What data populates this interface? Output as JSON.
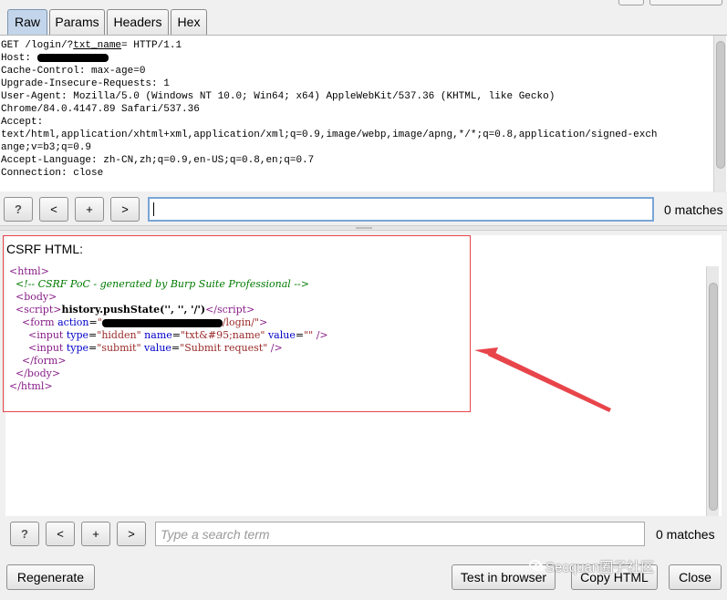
{
  "tabs": [
    "Raw",
    "Params",
    "Headers",
    "Hex"
  ],
  "request": {
    "line1_pre": "GET /login/?",
    "line1_ul": "txt_name",
    "line1_post": "= HTTP/1.1",
    "host_label": "Host: ",
    "lines": [
      "Cache-Control: max-age=0",
      "Upgrade-Insecure-Requests: 1",
      "User-Agent: Mozilla/5.0 (Windows NT 10.0; Win64; x64) AppleWebKit/537.36 (KHTML, like Gecko)",
      "Chrome/84.0.4147.89 Safari/537.36",
      "Accept:",
      "text/html,application/xhtml+xml,application/xml;q=0.9,image/webp,image/apng,*/*;q=0.8,application/signed-exch",
      "ange;v=b3;q=0.9",
      "Accept-Language: zh-CN,zh;q=0.9,en-US;q=0.8,en;q=0.7",
      "Connection: close"
    ]
  },
  "search1": {
    "help": "?",
    "prev": "<",
    "add": "+",
    "next": ">",
    "value": "",
    "matches": "0 matches"
  },
  "csrf": {
    "label": "CSRF HTML:",
    "comment": "<!-- CSRF PoC - generated by Burp Suite Professional -->",
    "push_state": "history.pushState('', '', '/')",
    "action_suffix": "/login/",
    "input1_name": "txt&#95;name",
    "input1_value": "",
    "input2_value": "Submit request"
  },
  "search2": {
    "help": "?",
    "prev": "<",
    "add": "+",
    "next": ">",
    "placeholder": "Type a search term",
    "matches": "0 matches"
  },
  "buttons": {
    "regenerate": "Regenerate",
    "test": "Test in browser",
    "copy": "Copy HTML",
    "close": "Close"
  },
  "watermark": "Secquan圈子社区",
  "colors": {
    "active_tab": "#c3d5ea",
    "highlight_box": "#e8454b",
    "arrow": "#e8454b"
  }
}
